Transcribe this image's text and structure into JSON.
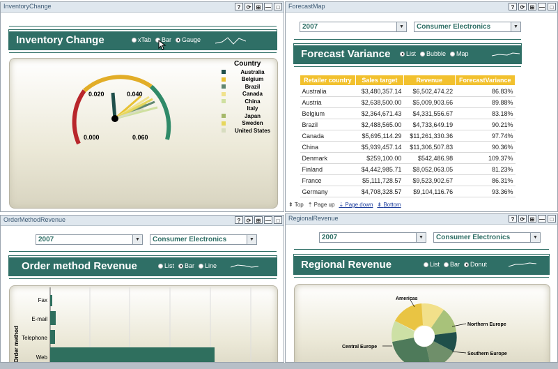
{
  "inventory": {
    "portlet_title": "InventoryChange",
    "header": "Inventory Change",
    "options": [
      {
        "label": "xTab",
        "on": false
      },
      {
        "label": "Bar",
        "on": false
      },
      {
        "label": "Gauge",
        "on": true
      }
    ],
    "gauge_labels": [
      "0.000",
      "0.020",
      "0.040",
      "0.060"
    ],
    "legend_title": "Country",
    "legend": [
      {
        "name": "Australia",
        "color": "#1f4f4a"
      },
      {
        "name": "Belgium",
        "color": "#e8c233"
      },
      {
        "name": "Brazil",
        "color": "#5f8670"
      },
      {
        "name": "Canada",
        "color": "#f0e28c"
      },
      {
        "name": "China",
        "color": "#cfe0a0"
      },
      {
        "name": "Italy",
        "color": ""
      },
      {
        "name": "Japan",
        "color": "#a5b86a"
      },
      {
        "name": "Sweden",
        "color": "#e6d75d"
      },
      {
        "name": "United States",
        "color": "#d7ddc0"
      }
    ]
  },
  "forecast": {
    "portlet_title": "ForecastMap",
    "year": "2007",
    "category": "Consumer Electronics",
    "header": "Forecast Variance",
    "options": [
      {
        "label": "List",
        "on": true
      },
      {
        "label": "Bubble",
        "on": false
      },
      {
        "label": "Map",
        "on": false
      }
    ],
    "columns": [
      "Retailer country",
      "Sales target",
      "Revenue",
      "ForecastVariance"
    ],
    "rows": [
      [
        "Australia",
        "$3,480,357.14",
        "$6,502,474.22",
        "86.83%"
      ],
      [
        "Austria",
        "$2,638,500.00",
        "$5,009,903.66",
        "89.88%"
      ],
      [
        "Belgium",
        "$2,364,671.43",
        "$4,331,556.67",
        "83.18%"
      ],
      [
        "Brazil",
        "$2,488,565.00",
        "$4,733,649.19",
        "90.21%"
      ],
      [
        "Canada",
        "$5,695,114.29",
        "$11,261,330.36",
        "97.74%"
      ],
      [
        "China",
        "$5,939,457.14",
        "$11,306,507.83",
        "90.36%"
      ],
      [
        "Denmark",
        "$259,100.00",
        "$542,486.98",
        "109.37%"
      ],
      [
        "Finland",
        "$4,442,985.71",
        "$8,052,063.05",
        "81.23%"
      ],
      [
        "France",
        "$5,111,728.57",
        "$9,523,902.67",
        "86.31%"
      ],
      [
        "Germany",
        "$4,708,328.57",
        "$9,104,116.76",
        "93.36%"
      ]
    ],
    "pager": {
      "top": "Top",
      "page_up": "Page up",
      "page_down": "Page down",
      "bottom": "Bottom"
    }
  },
  "order": {
    "portlet_title": "OrderMethodRevenue",
    "year": "2007",
    "category": "Consumer Electronics",
    "header": "Order method Revenue",
    "options": [
      {
        "label": "List",
        "on": false
      },
      {
        "label": "Bar",
        "on": true
      },
      {
        "label": "Line",
        "on": false
      }
    ],
    "axis_label": "Order method",
    "categories": [
      "Fax",
      "E-mail",
      "Telephone",
      "Web"
    ]
  },
  "regional": {
    "portlet_title": "RegionalRevenue",
    "year": "2007",
    "category": "Consumer Electronics",
    "header": "Regional Revenue",
    "options": [
      {
        "label": "List",
        "on": false
      },
      {
        "label": "Bar",
        "on": false
      },
      {
        "label": "Donut",
        "on": true
      }
    ],
    "labels": [
      "Americas",
      "Northern Europe",
      "Central Europe",
      "Southern Europe"
    ]
  },
  "portlet_buttons": [
    "?",
    "⟳",
    "⊞",
    "—",
    "□"
  ]
}
